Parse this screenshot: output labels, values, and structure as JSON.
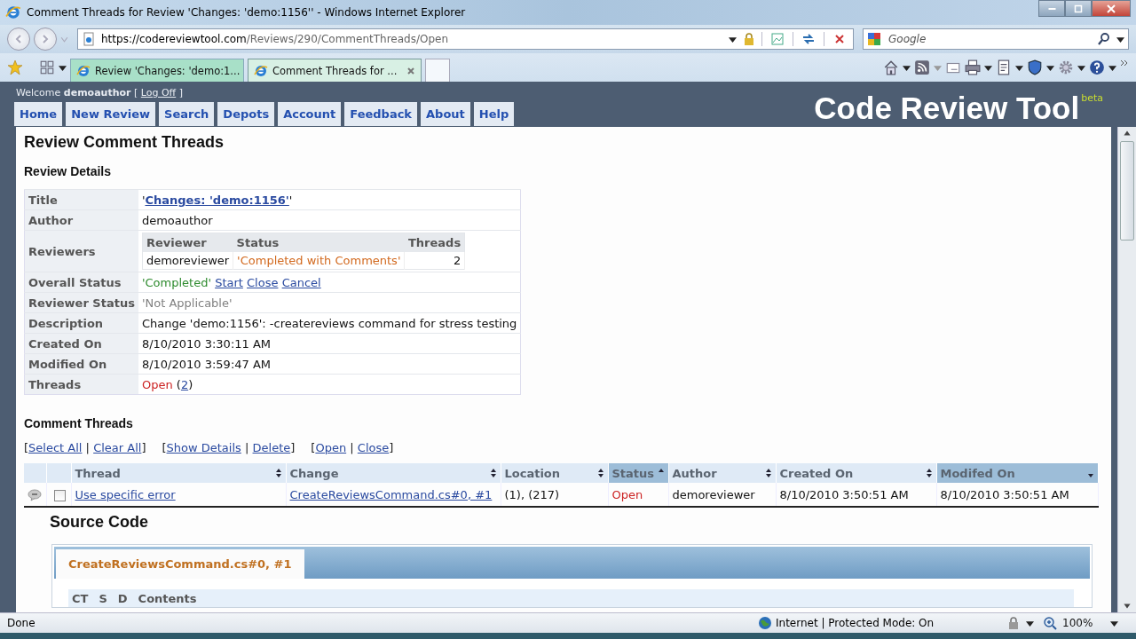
{
  "window": {
    "title": "Comment Threads for Review 'Changes: 'demo:1156'' - Windows Internet Explorer"
  },
  "address_bar": {
    "host": "https://codereviewtool.com",
    "path": "/Reviews/290/CommentThreads/Open"
  },
  "search": {
    "placeholder": "Google"
  },
  "tabs": [
    {
      "label": "Review 'Changes: 'demo:1...",
      "selected": false
    },
    {
      "label": "Comment Threads for ...",
      "selected": true
    }
  ],
  "site": {
    "welcome": "Welcome **demoauthor** [",
    "logoff": "Log Off",
    "welcome_end": "]",
    "brand": "Code Review Tool",
    "badge": "beta",
    "nav": [
      "Home",
      "New Review",
      "Search",
      "Depots",
      "Account",
      "Feedback",
      "About",
      "Help"
    ]
  },
  "page_title": "Review Comment Threads",
  "details": {
    "heading": "Review Details",
    "rows": [
      {
        "label": "Title",
        "kind": "parts",
        "parts": [
          {
            "text": "'"
          },
          {
            "text": "Changes: 'demo:1156'",
            "kind": "link-bold"
          },
          {
            "text": "'"
          }
        ]
      },
      {
        "label": "Author",
        "kind": "parts",
        "parts": [
          {
            "text": "demoauthor"
          }
        ]
      },
      {
        "label": "Reviewers",
        "kind": "table",
        "table": {
          "columns": [
            "Reviewer",
            "Status",
            "Threads"
          ],
          "rows": [
            {
              "reviewer": "demoreviewer",
              "status": "'Completed with Comments'",
              "color": "#d2691e",
              "threads": "2"
            }
          ]
        }
      },
      {
        "label": "Overall Status",
        "kind": "parts",
        "parts": [
          {
            "text": "'Completed'",
            "color": "#2e8b2e",
            "spaced": true
          },
          {
            "text": "Start",
            "kind": "link",
            "spaced": true
          },
          {
            "text": "Close",
            "kind": "link",
            "spaced": true
          },
          {
            "text": "Cancel",
            "kind": "link"
          }
        ]
      },
      {
        "label": "Reviewer Status",
        "kind": "parts",
        "parts": [
          {
            "text": "'Not Applicable'",
            "color": "#808080"
          }
        ]
      },
      {
        "label": "Description",
        "kind": "parts",
        "parts": [
          {
            "text": "Change 'demo:1156': -createreviews command for stress testing"
          }
        ]
      },
      {
        "label": "Created On",
        "kind": "parts",
        "parts": [
          {
            "text": "8/10/2010 3:30:11 AM"
          }
        ]
      },
      {
        "label": "Modified On",
        "kind": "parts",
        "parts": [
          {
            "text": "8/10/2010 3:59:47 AM"
          }
        ]
      },
      {
        "label": "Threads",
        "kind": "parts",
        "parts": [
          {
            "text": "Open",
            "color": "#cc2222",
            "spaced": true
          },
          {
            "text": "("
          },
          {
            "text": "2",
            "kind": "link"
          },
          {
            "text": ")"
          }
        ]
      }
    ]
  },
  "threads": {
    "heading": "Comment Threads",
    "actions": [
      [
        {
          "text": "["
        },
        {
          "text": "Select All",
          "kind": "link",
          "spaced": true
        },
        {
          "text": "|",
          "spaced": true
        },
        {
          "text": "Clear All",
          "kind": "link"
        },
        {
          "text": "]"
        }
      ],
      [
        {
          "text": "["
        },
        {
          "text": "Show Details",
          "kind": "link",
          "spaced": true
        },
        {
          "text": "|",
          "spaced": true
        },
        {
          "text": "Delete",
          "kind": "link"
        },
        {
          "text": "]"
        }
      ],
      [
        {
          "text": "["
        },
        {
          "text": "Open",
          "kind": "link",
          "spaced": true
        },
        {
          "text": "|",
          "spaced": true
        },
        {
          "text": "Close",
          "kind": "link"
        },
        {
          "text": "]"
        }
      ]
    ],
    "columns": [
      {
        "kind": "expander"
      },
      {
        "kind": "select"
      },
      {
        "kind": "sort",
        "label": "Thread",
        "sort_up": true,
        "sort_down": true,
        "selected": false
      },
      {
        "kind": "sort",
        "label": "Change",
        "sort_up": true,
        "sort_down": true,
        "selected": false
      },
      {
        "kind": "sort",
        "label": "Location",
        "sort_up": true,
        "sort_down": true,
        "selected": false
      },
      {
        "kind": "sort",
        "label": "Status",
        "sort_up": true,
        "sort_down": false,
        "selected": true
      },
      {
        "kind": "sort",
        "label": "Author",
        "sort_up": true,
        "sort_down": true,
        "selected": false
      },
      {
        "kind": "sort",
        "label": "Created On",
        "sort_up": true,
        "sort_down": true,
        "selected": false
      },
      {
        "kind": "sort",
        "label": "Modifed On",
        "sort_up": false,
        "sort_down": true,
        "selected": true
      }
    ],
    "rows": [
      {
        "expanded": true,
        "checked": false,
        "thread": "Use specific error",
        "change": "CreateReviewsCommand.cs#0, #1",
        "location": "(1), (217)",
        "status": "Open",
        "author": "demoreviewer",
        "created": "8/10/2010 3:50:51 AM",
        "modified": "8/10/2010 3:50:51 AM",
        "detail": {
          "heading": "Source Code",
          "file_tab": "CreateReviewsCommand.cs#0, #1",
          "columns": [
            "CT",
            "S",
            "D",
            "Contents"
          ]
        }
      }
    ]
  },
  "status_bar": {
    "text": "Done",
    "zone": "Internet | Protected Mode: On",
    "zoom": "100%"
  }
}
